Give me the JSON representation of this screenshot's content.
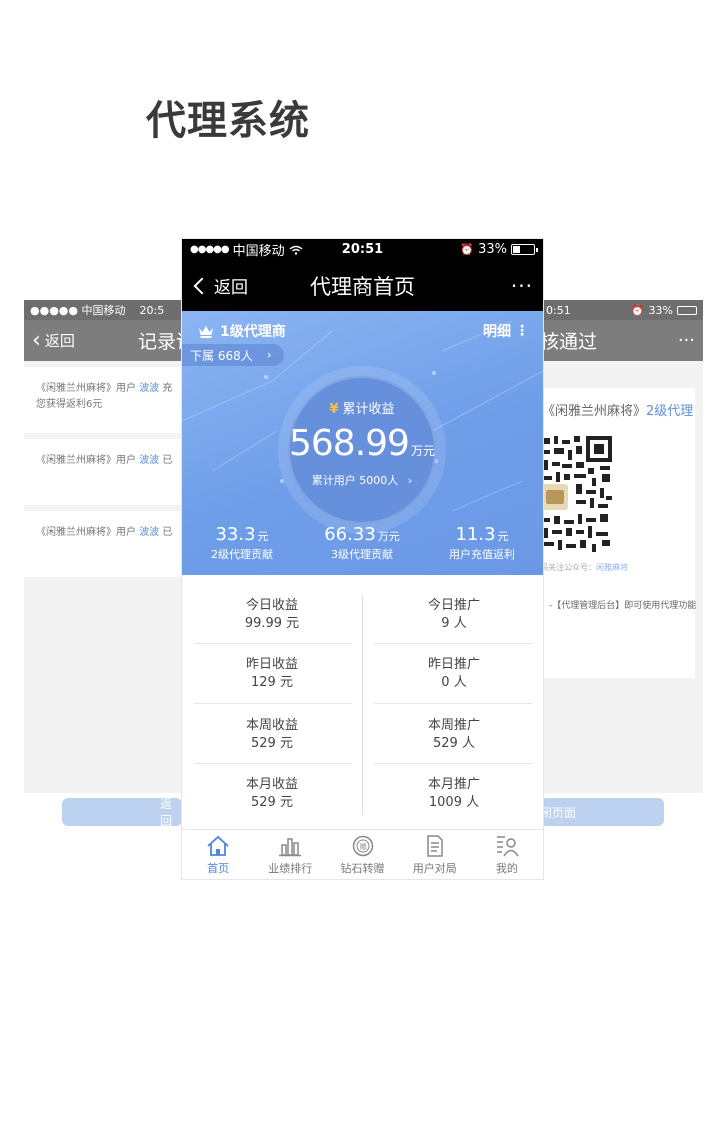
{
  "page_title": "代理系统",
  "left_screen": {
    "status": {
      "carrier": "●●●●● 中国移动",
      "time": "20:5"
    },
    "nav": {
      "back_label": "返回",
      "title": "记录详"
    },
    "records": [
      {
        "prefix": "《闲雅兰州麻将》用户 ",
        "user": "波波",
        "suffix": " 充",
        "line2": "您获得返利6元"
      },
      {
        "prefix": "《闲雅兰州麻将》用户 ",
        "user": "波波",
        "suffix": " 已",
        "line2": ""
      },
      {
        "prefix": "《闲雅兰州麻将》用户 ",
        "user": "波波",
        "suffix": " 已",
        "line2": ""
      }
    ],
    "bottom_button": "返 回"
  },
  "right_screen": {
    "status": {
      "time": "0:51",
      "battery": "33%"
    },
    "nav": {
      "title": "核通过",
      "more": "···"
    },
    "qr_line_prefix": "《闲雅兰州麻将》",
    "qr_line_level": "2级代理",
    "qr_caption_prefix": "码关注公众号：",
    "qr_caption_account": "闲雅麻将",
    "qr_note": "】-【代理管理后台】即可使用代理功能",
    "bottom_button": "闭页面"
  },
  "phone": {
    "status": {
      "carrier": "中国移动",
      "time": "20:51",
      "battery": "33%"
    },
    "nav": {
      "back_label": "返回",
      "title": "代理商首页",
      "more": "···"
    },
    "hero": {
      "level": "1级代理商",
      "detail": "明细",
      "subordinates_label": "下属 668人",
      "cumulative_label": "累计收益",
      "cumulative_amount": "568.99",
      "cumulative_unit": "万元",
      "cumulative_users": "累计用户 5000人",
      "stats": [
        {
          "value": "33.3",
          "unit": "元",
          "label": "2级代理贡献"
        },
        {
          "value": "66.33",
          "unit": "万元",
          "label": "3级代理贡献"
        },
        {
          "value": "11.3",
          "unit": "元",
          "label": "用户充值返利"
        }
      ]
    },
    "grid": {
      "left": [
        {
          "title": "今日收益",
          "value": "99.99 元"
        },
        {
          "title": "昨日收益",
          "value": "129 元"
        },
        {
          "title": "本周收益",
          "value": "529 元"
        },
        {
          "title": "本月收益",
          "value": "529 元"
        }
      ],
      "right": [
        {
          "title": "今日推广",
          "value": "9 人"
        },
        {
          "title": "昨日推广",
          "value": "0 人"
        },
        {
          "title": "本周推广",
          "value": "529 人"
        },
        {
          "title": "本月推广",
          "value": "1009 人"
        }
      ]
    },
    "tabs": [
      {
        "label": "首页",
        "icon": "home-icon",
        "active": true
      },
      {
        "label": "业绩排行",
        "icon": "bar-chart-icon",
        "active": false
      },
      {
        "label": "钻石转赠",
        "icon": "gift-icon",
        "active": false
      },
      {
        "label": "用户对局",
        "icon": "document-icon",
        "active": false
      },
      {
        "label": "我的",
        "icon": "user-list-icon",
        "active": false
      }
    ],
    "accent_color": "#4a86de"
  }
}
